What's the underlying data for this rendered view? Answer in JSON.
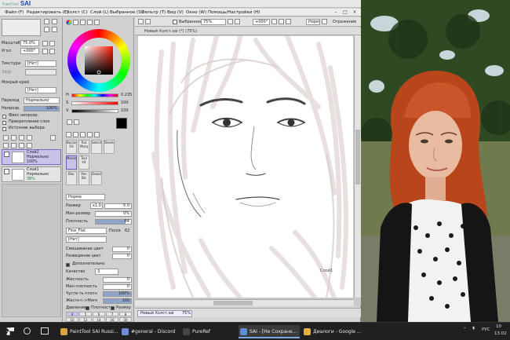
{
  "app": {
    "logo_prefix": "PaintTool",
    "logo": "SAI"
  },
  "menu": {
    "file": "Файл (F)",
    "edit": "Редактировать (E)",
    "canvas": "Холст (C)",
    "layer": "Слой (L)",
    "selection": "Выбранное (S)",
    "filter": "Фильтр (T)",
    "view": "Вид (V)",
    "window": "Окно (W)",
    "help": "Помощь/Настройки (H)"
  },
  "toolbar": {
    "selection_check_label": "Выбранное",
    "zoom": "75%",
    "rotation": "+000°",
    "mode": "Норм",
    "reflection_label": "Отражение"
  },
  "navigator": {
    "zoom_label": "Масштаб",
    "zoom_value": "75.0%",
    "angle_label": "Угол",
    "angle_value": "+000°"
  },
  "paper": {
    "texture_label": "Текстура",
    "texture_value": "[Нет]",
    "effect_label": "Эфф.",
    "wet_edge_label": "Мокрый край",
    "wet_edge_value": "[Нет]"
  },
  "layer_props": {
    "mode_label": "Переход",
    "mode_value": "Нормально",
    "opacity_label": "Непрозр.",
    "opacity_value": "100%",
    "opacity_pct": 100,
    "preserve_opacity": "Фикс непрозр.",
    "clipping": "Прикрепление слоя",
    "selection_source": "Источник выбора"
  },
  "layers": [
    {
      "name": "Слой2",
      "mode": "Нормально",
      "opacity": "100%"
    },
    {
      "name": "Слой1",
      "mode": "Нормально",
      "opacity": "38%"
    }
  ],
  "color": {
    "h_label": "H",
    "h_value": "0.235",
    "s_label": "S",
    "s_value": "100",
    "v_label": "V",
    "v_value": "100",
    "primary": "#000000",
    "secondary": "#ffffff"
  },
  "tools": {
    "bucket": "Bucket Fill",
    "ruler": "Rul Marq",
    "select": "Select",
    "deselect": "Deselect",
    "marker": "Marker",
    "toolkit": "Tool kit",
    "blur": "Blur",
    "pen": "Pen Blc",
    "details": "Details"
  },
  "brush": {
    "mode_value": "Норма",
    "size_label": "Размер",
    "size_mult": "x1.0",
    "size_value": "5.0",
    "min_size_label": "Мин размер",
    "min_size_value": "0%",
    "density_label": "Плотность",
    "density_value": "84",
    "shape_value": "Fine_Flat",
    "shape_strength_label": "Пол/а",
    "shape_strength_value": "62",
    "texture_value": "[Нет]",
    "blending_label": "Смешивание цвет",
    "blending_value": "0",
    "dilution_label": "Разведение цвет",
    "dilution_value": "0",
    "advanced_label": "Дополнительно",
    "quality_label": "Качество",
    "quality_value": "3",
    "hardness_label": "Жесткость",
    "hardness_value": "0",
    "min_density_label": "Мин плотность",
    "min_density_value": "0",
    "sensitivity_label": "Чуств-ть плотн",
    "sensitivity_value": "100%",
    "smooth_label": "Жестк<->Мягк",
    "smooth_value": "100",
    "pressure_label": "Давление",
    "pressure_density": "Плотность",
    "pressure_size": "Размер",
    "dot_sizes": [
      "4",
      "5",
      "6",
      "7",
      "8",
      "10",
      "12",
      "14",
      "16",
      "20"
    ]
  },
  "canvas": {
    "title": "Новый Холст.sai (*) (75%)",
    "tab_label": "Новый Холст.sai",
    "tab_zoom": "75%",
    "layer_tag": "Слой1"
  },
  "taskbar": {
    "items": [
      {
        "label": "PaintTool SAI Russi...",
        "color": "#d9a441"
      },
      {
        "label": "#general - Discord",
        "color": "#7289da"
      },
      {
        "label": "PureRef",
        "color": "#444444"
      },
      {
        "label": "SAI - [Не Сохране...",
        "color": "#5b8cd6"
      },
      {
        "label": "Диалоги - Google ...",
        "color": "#e0b13b"
      }
    ],
    "lang": "РУС",
    "time": "10",
    "date": "13.02"
  },
  "colors": {
    "accent": "#c9c3ea",
    "taskbar": "#202020"
  }
}
